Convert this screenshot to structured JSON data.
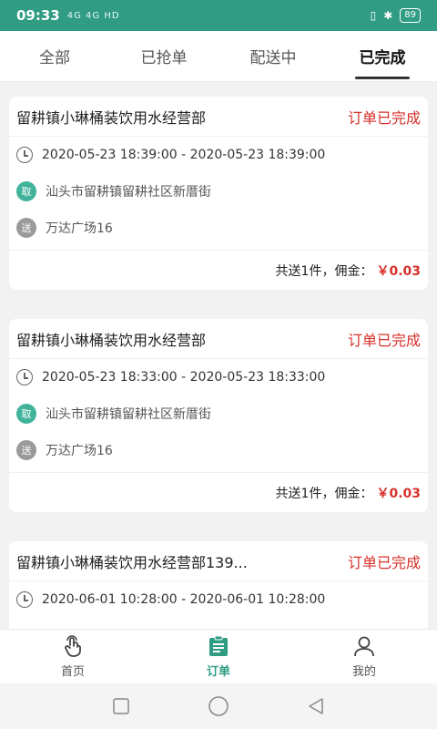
{
  "status_bar": {
    "time": "09:33",
    "network": "4G 4G HD",
    "battery": "89"
  },
  "tabs": [
    {
      "label": "全部",
      "active": false
    },
    {
      "label": "已抢单",
      "active": false
    },
    {
      "label": "配送中",
      "active": false
    },
    {
      "label": "已完成",
      "active": true
    }
  ],
  "orders": [
    {
      "shop": "留耕镇小琳桶装饮用水经营部",
      "status": "订单已完成",
      "time": "2020-05-23 18:39:00 - 2020-05-23 18:39:00",
      "pickup_badge": "取",
      "pickup": "汕头市留耕镇留耕社区新厝街",
      "send_badge": "送",
      "dropoff": "万达广场16",
      "summary": "共送1件，佣金：",
      "fee": "￥0.03"
    },
    {
      "shop": "留耕镇小琳桶装饮用水经营部",
      "status": "订单已完成",
      "time": "2020-05-23 18:33:00 - 2020-05-23 18:33:00",
      "pickup_badge": "取",
      "pickup": "汕头市留耕镇留耕社区新厝街",
      "send_badge": "送",
      "dropoff": "万达广场16",
      "summary": "共送1件，佣金：",
      "fee": "￥0.03"
    },
    {
      "shop": "留耕镇小琳桶装饮用水经营部139...",
      "status": "订单已完成",
      "time": "2020-06-01 10:28:00 - 2020-06-01 10:28:00"
    }
  ],
  "bottom_nav": [
    {
      "label": "首页",
      "icon": "hand-touch-icon"
    },
    {
      "label": "订单",
      "icon": "clipboard-icon"
    },
    {
      "label": "我的",
      "icon": "person-icon"
    }
  ],
  "colors": {
    "accent": "#2f9c83",
    "status_red": "#d8302a"
  }
}
